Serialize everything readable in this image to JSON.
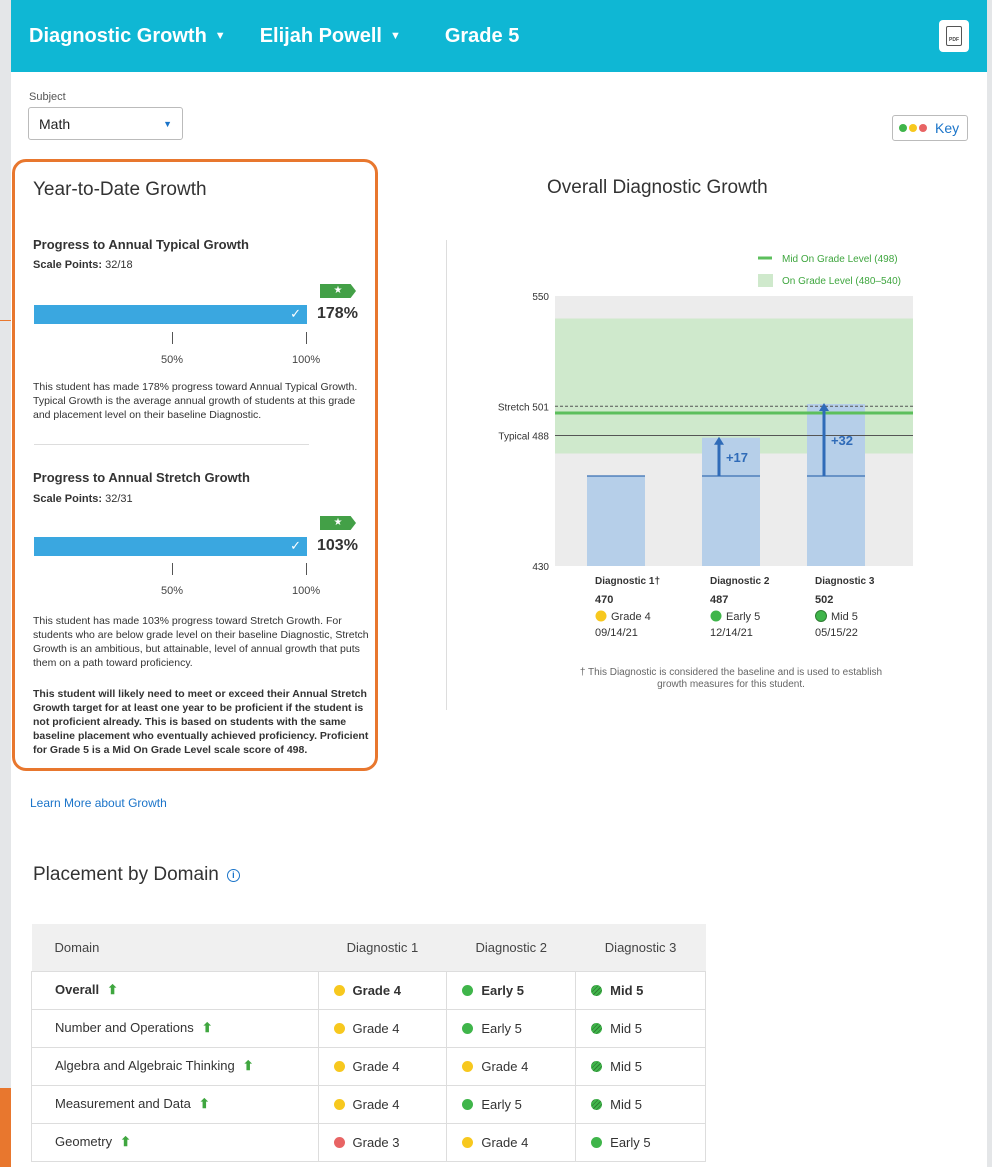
{
  "header": {
    "report": "Diagnostic Growth",
    "student": "Elijah Powell",
    "grade": "Grade 5",
    "pdf_label": "PDF"
  },
  "subject": {
    "label": "Subject",
    "value": "Math"
  },
  "key": {
    "label": "Key",
    "colors": [
      "#3fb54a",
      "#f7c81e",
      "#e86464"
    ]
  },
  "ytd": {
    "title": "Year-to-Date Growth",
    "typical": {
      "title": "Progress to Annual Typical Growth",
      "scale_label": "Scale Points:",
      "scale_value": "32/18",
      "percent": "178%",
      "tick_50": "50%",
      "tick_100": "100%",
      "text": "This student has made 178% progress toward Annual Typical Growth. Typical Growth is the average annual growth of students at this grade and placement level on their baseline Diagnostic."
    },
    "stretch": {
      "title": "Progress to Annual Stretch Growth",
      "scale_label": "Scale Points:",
      "scale_value": "32/31",
      "percent": "103%",
      "tick_50": "50%",
      "tick_100": "100%",
      "text": "This student has made 103% progress toward Stretch Growth. For students who are below grade level on their baseline Diagnostic, Stretch Growth is an ambitious, but attainable, level of annual growth that puts them on a path toward proficiency.",
      "note": "This student will likely need to meet or exceed their Annual Stretch Growth target for at least one year to be proficient if the student is not proficient already. This is based on students with the same baseline placement who eventually achieved proficiency. Proficient for Grade 5 is a Mid On Grade Level scale score of 498."
    }
  },
  "learn_more": "Learn More about Growth",
  "chart_data": {
    "type": "bar",
    "title": "Overall Diagnostic Growth",
    "ylim": [
      430,
      550
    ],
    "y_ticks": [
      "550",
      "430"
    ],
    "categories": [
      "Diagnostic 1",
      "Diagnostic 2",
      "Diagnostic 3"
    ],
    "values": [
      470,
      487,
      502
    ],
    "growth_labels": [
      "",
      "+17",
      "+32"
    ],
    "placements": [
      "Grade 4",
      "Early 5",
      "Mid 5"
    ],
    "dates": [
      "09/14/21",
      "12/14/21",
      "05/15/22"
    ],
    "reference_lines": [
      {
        "label": "Stretch 501",
        "value": 501
      },
      {
        "label": "Typical 488",
        "value": 488
      }
    ],
    "legend": [
      {
        "label": "Mid On Grade Level (498)",
        "value": 498,
        "color": "#5cbf5c"
      },
      {
        "label": "On Grade Level (480–540)",
        "range": [
          480,
          540
        ],
        "color": "#cfe9cc"
      }
    ],
    "baseline_mark": "†",
    "footnote": "† This Diagnostic is considered the baseline and is used to establish growth measures for this student."
  },
  "placement": {
    "title": "Placement by Domain",
    "info_icon": "info-icon",
    "columns": [
      "Domain",
      "Diagnostic 1",
      "Diagnostic 2",
      "Diagnostic 3"
    ],
    "rows": [
      {
        "domain": "Overall",
        "values": [
          [
            "Grade 4",
            "yellow"
          ],
          [
            "Early 5",
            "green"
          ],
          [
            "Mid 5",
            "stripe"
          ]
        ]
      },
      {
        "domain": "Number and Operations",
        "values": [
          [
            "Grade 4",
            "yellow"
          ],
          [
            "Early 5",
            "green"
          ],
          [
            "Mid 5",
            "stripe"
          ]
        ]
      },
      {
        "domain": "Algebra and Algebraic Thinking",
        "values": [
          [
            "Grade 4",
            "yellow"
          ],
          [
            "Grade 4",
            "yellow"
          ],
          [
            "Mid 5",
            "stripe"
          ]
        ]
      },
      {
        "domain": "Measurement and Data",
        "values": [
          [
            "Grade 4",
            "yellow"
          ],
          [
            "Early 5",
            "green"
          ],
          [
            "Mid 5",
            "stripe"
          ]
        ]
      },
      {
        "domain": "Geometry",
        "values": [
          [
            "Grade 3",
            "red"
          ],
          [
            "Grade 4",
            "yellow"
          ],
          [
            "Early 5",
            "green"
          ]
        ]
      }
    ]
  }
}
